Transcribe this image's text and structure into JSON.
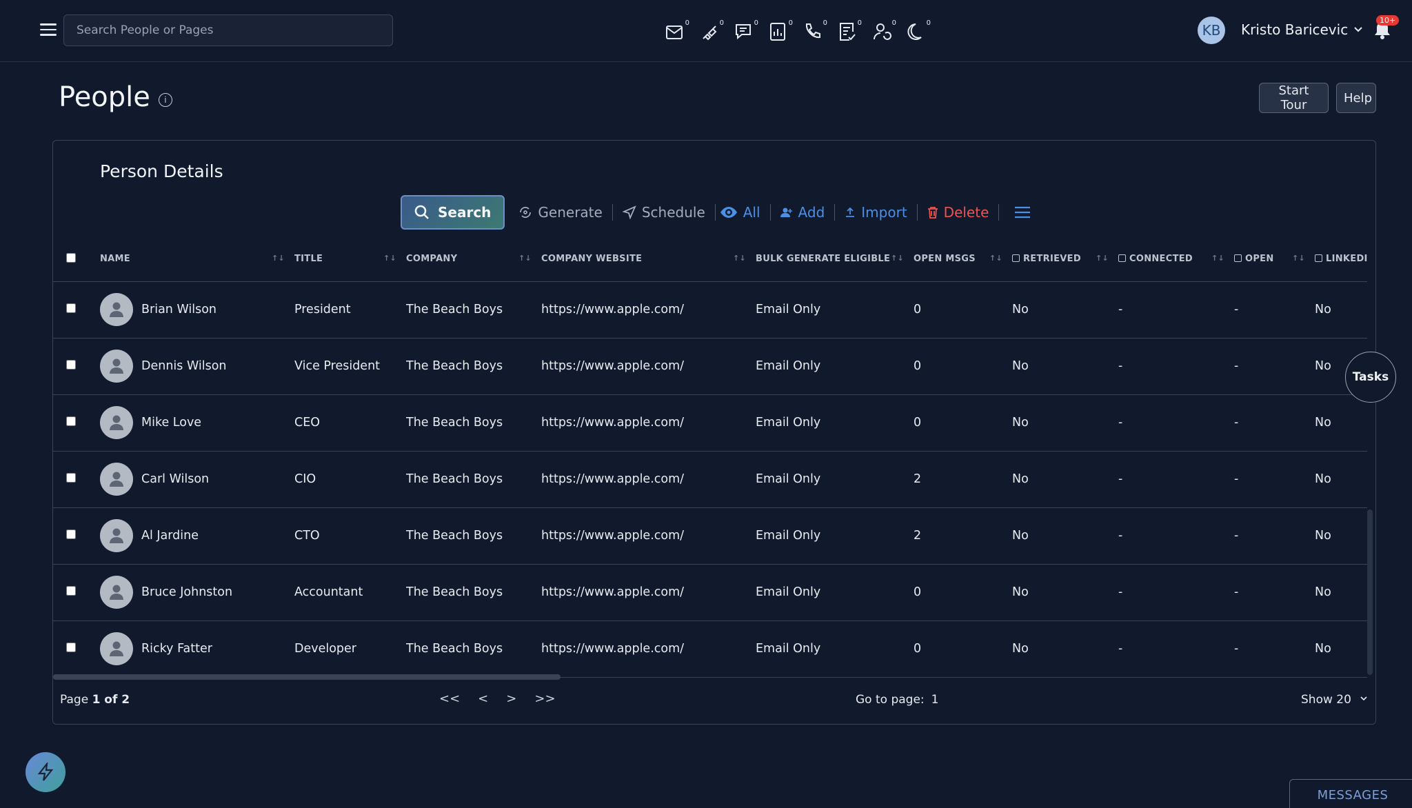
{
  "topbar": {
    "search_placeholder": "Search People or Pages",
    "stats": [
      {
        "icon": "mail-in-icon",
        "count": "0"
      },
      {
        "icon": "unplugged-icon",
        "count": "0"
      },
      {
        "icon": "chat-icon",
        "count": "0"
      },
      {
        "icon": "report-icon",
        "count": "0"
      },
      {
        "icon": "phone-icon",
        "count": "0"
      },
      {
        "icon": "checklist-icon",
        "count": "0"
      },
      {
        "icon": "person-refresh-icon",
        "count": "0"
      },
      {
        "icon": "moon-icon",
        "count": "0"
      }
    ],
    "avatar_initials": "KB",
    "user_name": "Kristo Baricevic",
    "notifications_badge": "10+"
  },
  "page": {
    "title": "People",
    "start_tour": "Start Tour",
    "help": "Help"
  },
  "card": {
    "title": "Person Details",
    "toolbar": {
      "search": "Search",
      "generate": "Generate",
      "schedule": "Schedule",
      "all": "All",
      "add": "Add",
      "import": "Import",
      "delete": "Delete"
    }
  },
  "table": {
    "columns": [
      "NAME",
      "TITLE",
      "COMPANY",
      "COMPANY WEBSITE",
      "BULK GENERATE ELIGIBLE",
      "OPEN MSGS",
      "RETRIEVED",
      "CONNECTED",
      "OPEN",
      "LINKEDI"
    ],
    "rows": [
      {
        "name": "Brian Wilson",
        "title": "President",
        "company": "The Beach Boys",
        "website": "https://www.apple.com/",
        "bulk": "Email Only",
        "open_msgs": "0",
        "retrieved": "No",
        "connected": "-",
        "open": "-",
        "linkedin": "No"
      },
      {
        "name": "Dennis Wilson",
        "title": "Vice President",
        "company": "The Beach Boys",
        "website": "https://www.apple.com/",
        "bulk": "Email Only",
        "open_msgs": "0",
        "retrieved": "No",
        "connected": "-",
        "open": "-",
        "linkedin": "No"
      },
      {
        "name": "Mike Love",
        "title": "CEO",
        "company": "The Beach Boys",
        "website": "https://www.apple.com/",
        "bulk": "Email Only",
        "open_msgs": "0",
        "retrieved": "No",
        "connected": "-",
        "open": "-",
        "linkedin": "No"
      },
      {
        "name": "Carl Wilson",
        "title": "CIO",
        "company": "The Beach Boys",
        "website": "https://www.apple.com/",
        "bulk": "Email Only",
        "open_msgs": "2",
        "retrieved": "No",
        "connected": "-",
        "open": "-",
        "linkedin": "No"
      },
      {
        "name": "Al Jardine",
        "title": "CTO",
        "company": "The Beach Boys",
        "website": "https://www.apple.com/",
        "bulk": "Email Only",
        "open_msgs": "2",
        "retrieved": "No",
        "connected": "-",
        "open": "-",
        "linkedin": "No"
      },
      {
        "name": "Bruce Johnston",
        "title": "Accountant",
        "company": "The Beach Boys",
        "website": "https://www.apple.com/",
        "bulk": "Email Only",
        "open_msgs": "0",
        "retrieved": "No",
        "connected": "-",
        "open": "-",
        "linkedin": "No"
      },
      {
        "name": "Ricky Fatter",
        "title": "Developer",
        "company": "The Beach Boys",
        "website": "https://www.apple.com/",
        "bulk": "Email Only",
        "open_msgs": "0",
        "retrieved": "No",
        "connected": "-",
        "open": "-",
        "linkedin": "No"
      }
    ]
  },
  "pagination": {
    "page_prefix": "Page",
    "page_value": "1 of 2",
    "first": "<<",
    "prev": "<",
    "next": ">",
    "last": ">>",
    "goto_label": "Go to page:",
    "goto_value": "1",
    "show_label": "Show 20"
  },
  "floating": {
    "tasks": "Tasks",
    "messages": "MESSAGES"
  }
}
